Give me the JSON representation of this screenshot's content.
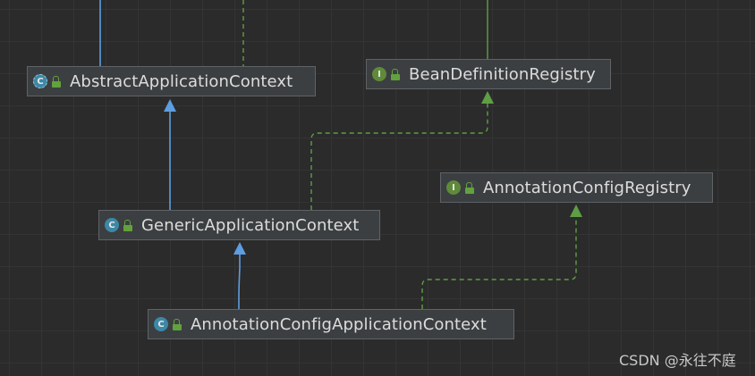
{
  "nodes": {
    "abstract_application_context": {
      "name": "AbstractApplicationContext",
      "kind": "abstract class",
      "badge": "C"
    },
    "bean_definition_registry": {
      "name": "BeanDefinitionRegistry",
      "kind": "interface",
      "badge": "I"
    },
    "generic_application_context": {
      "name": "GenericApplicationContext",
      "kind": "class",
      "badge": "C"
    },
    "annotation_config_registry": {
      "name": "AnnotationConfigRegistry",
      "kind": "interface",
      "badge": "I"
    },
    "annotation_config_application_context": {
      "name": "AnnotationConfigApplicationContext",
      "kind": "class",
      "badge": "C"
    }
  },
  "relations": [
    {
      "from": "GenericApplicationContext",
      "to": "AbstractApplicationContext",
      "type": "extends"
    },
    {
      "from": "GenericApplicationContext",
      "to": "BeanDefinitionRegistry",
      "type": "implements"
    },
    {
      "from": "AnnotationConfigApplicationContext",
      "to": "GenericApplicationContext",
      "type": "extends"
    },
    {
      "from": "AnnotationConfigApplicationContext",
      "to": "AnnotationConfigRegistry",
      "type": "implements"
    }
  ],
  "colors": {
    "background": "#2b2b2b",
    "extends_edge": "#5d9de0",
    "implements_edge": "#5e9e45",
    "visibility_icon": "#62a23e",
    "class_badge": "#3d88a6",
    "interface_badge": "#5f8a3a"
  },
  "watermark": "CSDN @永往不庭"
}
